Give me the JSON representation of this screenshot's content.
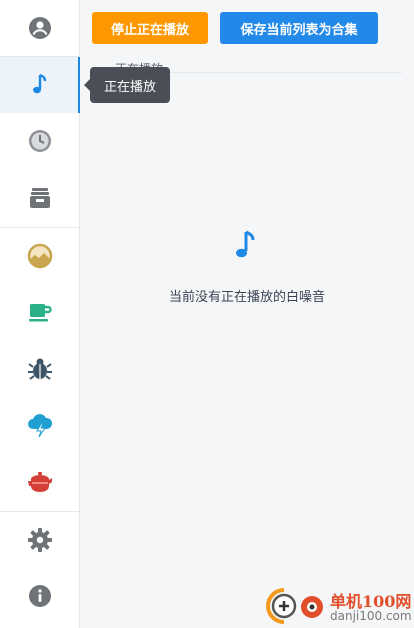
{
  "sidebar": {
    "items": [
      {
        "icon": "user-circle-icon",
        "color": "#6f7378"
      },
      {
        "icon": "music-note-icon",
        "color": "#1e88e5",
        "active": true
      },
      {
        "icon": "clock-icon",
        "color": "#8e9196"
      },
      {
        "icon": "archive-box-icon",
        "color": "#6f7378"
      },
      {
        "icon": "landscape-circle-icon",
        "color": "#c9a64e"
      },
      {
        "icon": "coffee-cup-icon",
        "color": "#2bb08a"
      },
      {
        "icon": "bug-icon",
        "color": "#3d5566"
      },
      {
        "icon": "thunder-cloud-icon",
        "color": "#1f9fd2"
      },
      {
        "icon": "teapot-icon",
        "color": "#d33f35"
      },
      {
        "icon": "gear-icon",
        "color": "#6f7378"
      },
      {
        "icon": "info-circle-icon",
        "color": "#6f7378"
      }
    ]
  },
  "toolbar": {
    "stop_label": "停止正在播放",
    "save_label": "保存当前列表为合集",
    "stop_color": "#ff9800",
    "save_color": "#2289e9"
  },
  "section": {
    "title": "正在播放"
  },
  "tooltip": {
    "text": "正在播放"
  },
  "empty": {
    "icon": "music-note-icon",
    "message": "当前没有正在播放的白噪音",
    "icon_color": "#1e88e5"
  },
  "watermark": {
    "title": "单机100网",
    "url": "danji100.com"
  }
}
